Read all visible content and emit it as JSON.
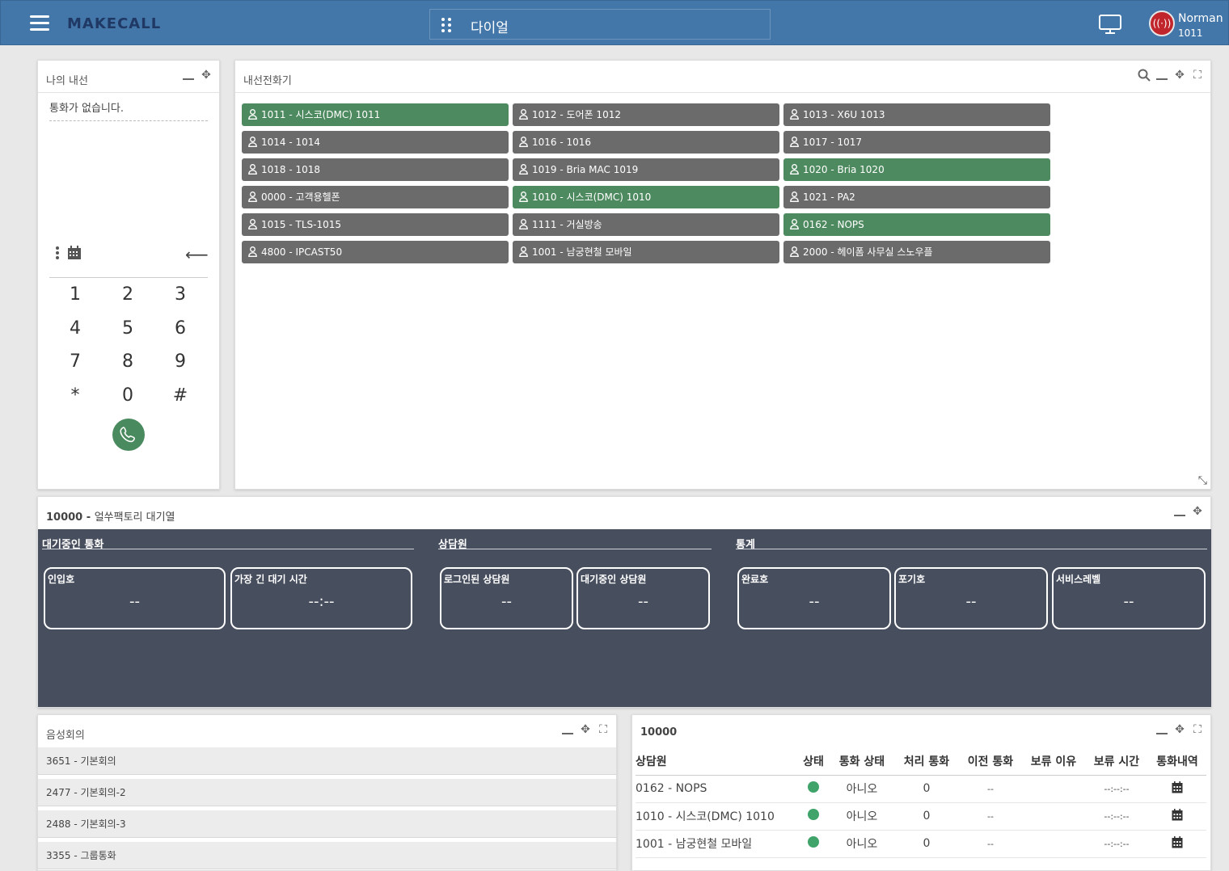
{
  "header": {
    "logo": "MAKECALL",
    "dial_label": "다이얼",
    "user_name": "Norman",
    "user_ext": "1011"
  },
  "my_line": {
    "title": "나의 내선",
    "no_call": "통화가 없습니다.",
    "keys": [
      "1",
      "2",
      "3",
      "4",
      "5",
      "6",
      "7",
      "8",
      "9",
      "*",
      "0",
      "#"
    ]
  },
  "extensions": {
    "title": "내선전화기",
    "items": [
      {
        "label": "1011 - 시스코(DMC) 1011",
        "status": "green"
      },
      {
        "label": "1012 - 도어폰 1012",
        "status": "grey"
      },
      {
        "label": "1013 - X6U 1013",
        "status": "grey"
      },
      {
        "label": "1014 - 1014",
        "status": "grey"
      },
      {
        "label": "1016 - 1016",
        "status": "grey"
      },
      {
        "label": "1017 - 1017",
        "status": "grey"
      },
      {
        "label": "1018 - 1018",
        "status": "grey"
      },
      {
        "label": "1019 - Bria MAC 1019",
        "status": "grey"
      },
      {
        "label": "1020 - Bria 1020",
        "status": "green"
      },
      {
        "label": "0000 - 고객용헬폰",
        "status": "grey"
      },
      {
        "label": "1010 - 시스코(DMC) 1010",
        "status": "green"
      },
      {
        "label": "1021 - PA2",
        "status": "grey"
      },
      {
        "label": "1015 - TLS-1015",
        "status": "grey"
      },
      {
        "label": "1111 - 거실방송",
        "status": "grey"
      },
      {
        "label": "0162 - NOPS",
        "status": "green"
      },
      {
        "label": "4800 - IPCAST50",
        "status": "grey"
      },
      {
        "label": "1001 - 남궁현철 모바일",
        "status": "grey"
      },
      {
        "label": "2000 - 헤이폼 사무실 스노우플",
        "status": "grey"
      }
    ]
  },
  "queue": {
    "title_num": "10000",
    "title_sep": " - ",
    "title_name": "얼쑤팩토리 대기열",
    "section_waiting": "대기중인 통화",
    "section_agents": "상담원",
    "section_stats": "통계",
    "stats": [
      {
        "label": "인입호",
        "value": "--"
      },
      {
        "label": "가장 긴 대기 시간",
        "value": "--:--"
      },
      {
        "label": "로그인된 상담원",
        "value": "--"
      },
      {
        "label": "대기중인 상담원",
        "value": "--"
      },
      {
        "label": "완료호",
        "value": "--"
      },
      {
        "label": "포기호",
        "value": "--"
      },
      {
        "label": "서비스레벨",
        "value": "--"
      }
    ]
  },
  "conference": {
    "title": "음성회의",
    "items": [
      "3651 - 기본회의",
      "2477 - 기본회의-2",
      "2488 - 기본회의-3",
      "3355 - 그룹통화"
    ]
  },
  "agents": {
    "title": "10000",
    "columns": [
      "상담원",
      "상태",
      "통화 상태",
      "처리 통화",
      "이전 통화",
      "보류 이유",
      "보류 시간",
      "통화내역"
    ],
    "rows": [
      {
        "name": "0162 - NOPS",
        "call_state": "아니오",
        "handled": "0",
        "prev": "--",
        "hold_reason": "",
        "hold_time": "--:--:--"
      },
      {
        "name": "1010 - 시스코(DMC) 1010",
        "call_state": "아니오",
        "handled": "0",
        "prev": "--",
        "hold_reason": "",
        "hold_time": "--:--:--"
      },
      {
        "name": "1001 - 남궁현철 모바일",
        "call_state": "아니오",
        "handled": "0",
        "prev": "--",
        "hold_reason": "",
        "hold_time": "--:--:--"
      }
    ]
  },
  "colors": {
    "header": "#4377a9",
    "ext_green": "#4e8a5f",
    "ext_grey": "#6b6b6b",
    "queue_bg": "#474e5e",
    "status_dot": "#3fa36a"
  }
}
